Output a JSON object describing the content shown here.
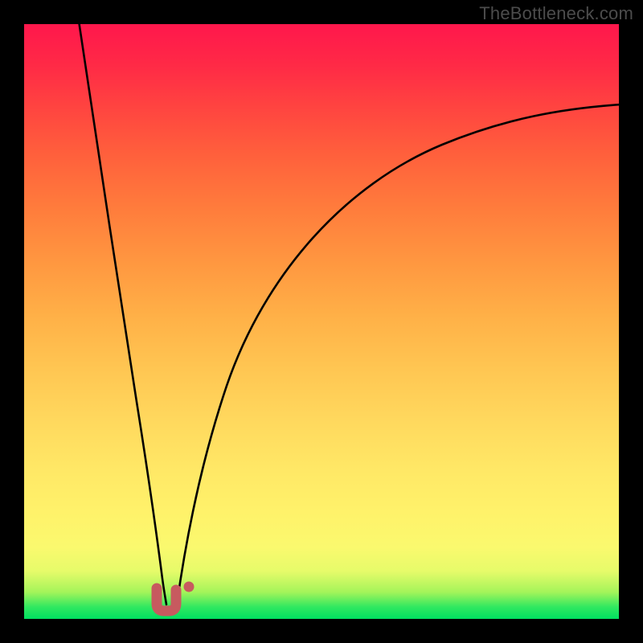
{
  "watermark": "TheBottleneck.com",
  "colors": {
    "frame": "#000000",
    "curve": "#000000",
    "marker": "#c75a5f",
    "gradient_top": "#ff174c",
    "gradient_bottom": "#00e060"
  },
  "chart_data": {
    "type": "line",
    "title": "",
    "xlabel": "",
    "ylabel": "",
    "xlim": [
      0,
      100
    ],
    "ylim": [
      0,
      100
    ],
    "series": [
      {
        "name": "left-descending-curve",
        "x": [
          10,
          12,
          14,
          16,
          18,
          20,
          22,
          23,
          23.5
        ],
        "values": [
          100,
          82,
          66,
          51,
          38,
          26,
          15,
          8,
          4
        ]
      },
      {
        "name": "right-ascending-curve",
        "x": [
          25,
          27,
          30,
          34,
          40,
          48,
          58,
          70,
          84,
          100
        ],
        "values": [
          4,
          14,
          28,
          42,
          55,
          65,
          73,
          78,
          82,
          84
        ]
      }
    ],
    "markers": [
      {
        "name": "valley-u-marker",
        "shape": "u",
        "x": 23.5,
        "y": 3,
        "width": 3.2,
        "height": 3.5
      },
      {
        "name": "side-dot-marker",
        "shape": "dot",
        "x": 27.3,
        "y": 5.8,
        "r": 0.9
      }
    ],
    "notes": "Gradient background encodes bottleneck severity from green (low, bottom) to red (high, top). Black curves show mismatch magnitude vs. an implicit horizontal parameter; minimum around x≈24 is highlighted."
  }
}
